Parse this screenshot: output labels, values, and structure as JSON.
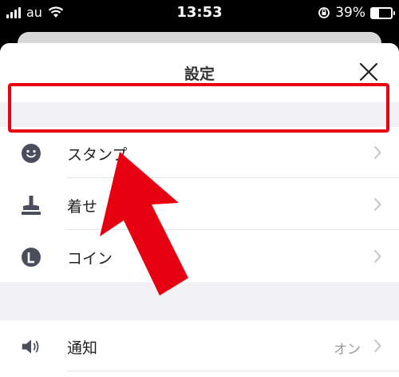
{
  "status_bar": {
    "carrier": "au",
    "time": "13:53",
    "battery_percent": "39%",
    "battery_level": 0.39
  },
  "sheet": {
    "title": "設定",
    "close_icon": "close-icon"
  },
  "settings": {
    "items": [
      {
        "label": "スタンプ",
        "icon": "smiley-icon"
      },
      {
        "label": "着せ",
        "icon": "theme-icon"
      },
      {
        "label": "コイン",
        "icon": "coin-icon"
      }
    ],
    "notifications": {
      "label": "通知",
      "value": "オン",
      "icon": "speaker-icon"
    }
  },
  "annotation": {
    "highlight_color": "#e60012",
    "arrow_color": "#e60012"
  }
}
